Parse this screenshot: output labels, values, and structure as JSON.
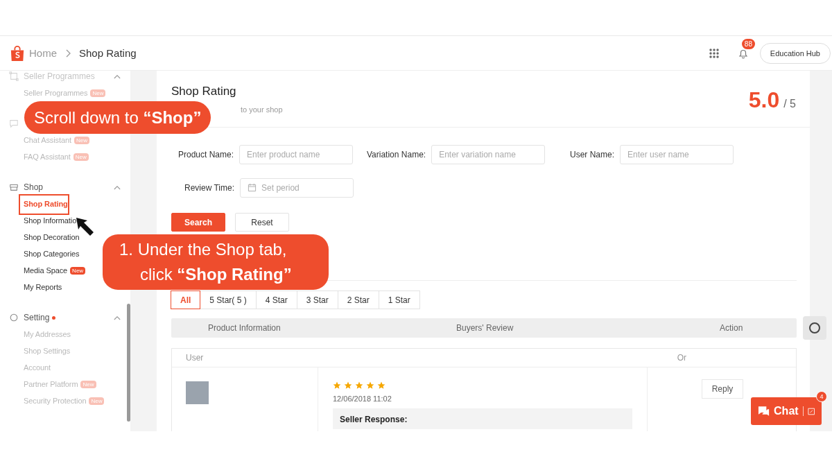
{
  "header": {
    "breadcrumb": [
      "Home",
      "Shop Rating"
    ],
    "notification_count": "88",
    "education_hub": "Education Hub"
  },
  "sidebar": {
    "sections": [
      {
        "title": "Seller Programmes",
        "faded": true,
        "items": [
          {
            "label": "Seller Programmes",
            "badge": "New",
            "selected": false,
            "faded": true
          }
        ]
      },
      {
        "faded": true,
        "items": [
          {
            "label": "Chat Assistant",
            "badge": "New",
            "selected": false,
            "faded": true
          },
          {
            "label": "FAQ Assistant",
            "badge": "New",
            "selected": false,
            "faded": true
          }
        ]
      },
      {
        "title": "Shop",
        "faded": false,
        "items": [
          {
            "label": "Shop Rating",
            "selected": true,
            "faded": false
          },
          {
            "label": "Shop Informatio",
            "selected": false,
            "faded": false
          },
          {
            "label": "Shop Decoration",
            "selected": false,
            "faded": false
          },
          {
            "label": "Shop Categories",
            "selected": false,
            "faded": false
          },
          {
            "label": "Media Space",
            "badge": "New",
            "selected": false,
            "faded": false
          },
          {
            "label": "My Reports",
            "selected": false,
            "faded": false
          }
        ]
      },
      {
        "title": "Setting",
        "faded": false,
        "dot": true,
        "items": [
          {
            "label": "My Addresses",
            "selected": false,
            "faded": true
          },
          {
            "label": "Shop Settings",
            "selected": false,
            "faded": true
          },
          {
            "label": "Account",
            "selected": false,
            "faded": true
          },
          {
            "label": "Partner Platform",
            "badge": "New",
            "selected": false,
            "faded": true
          },
          {
            "label": "Security Protection",
            "badge": "New",
            "selected": false,
            "faded": true
          }
        ]
      }
    ]
  },
  "page": {
    "title": "Shop Rating",
    "subtitle": "to your shop",
    "rating": "5.0",
    "rating_max": "/ 5",
    "filters": [
      {
        "label": "Product Name:",
        "placeholder": "Enter product name",
        "kind": "text"
      },
      {
        "label": "Variation Name:",
        "placeholder": "Enter variation name",
        "kind": "text"
      },
      {
        "label": "User Name:",
        "placeholder": "Enter user name",
        "kind": "text"
      },
      {
        "label": "Review Time:",
        "placeholder": "Set period",
        "kind": "date"
      }
    ],
    "buttons": [
      "Search",
      "Reset"
    ],
    "tabs": [
      {
        "label": "All",
        "selected": true
      },
      {
        "label": "5 Star( 5 )",
        "selected": false
      },
      {
        "label": "4 Star",
        "selected": false
      },
      {
        "label": "3 Star",
        "selected": false
      },
      {
        "label": "2 Star",
        "selected": false
      },
      {
        "label": "1 Star",
        "selected": false
      }
    ],
    "table": {
      "columns": [
        "Product Information",
        "Buyers' Review",
        "Action"
      ],
      "row_header": [
        "User",
        "Or"
      ],
      "review": {
        "stars": 5,
        "date": "12/06/2018 11:02",
        "seller_response": "Seller Response:",
        "action": "Reply"
      }
    }
  },
  "chat": {
    "label": "Chat",
    "count": "4"
  },
  "callouts": [
    {
      "lines": [
        "Scroll down to **“Shop”**"
      ]
    },
    {
      "lines": [
        "1. Under the Shop tab,",
        "click **“Shop Rating”**"
      ]
    }
  ]
}
